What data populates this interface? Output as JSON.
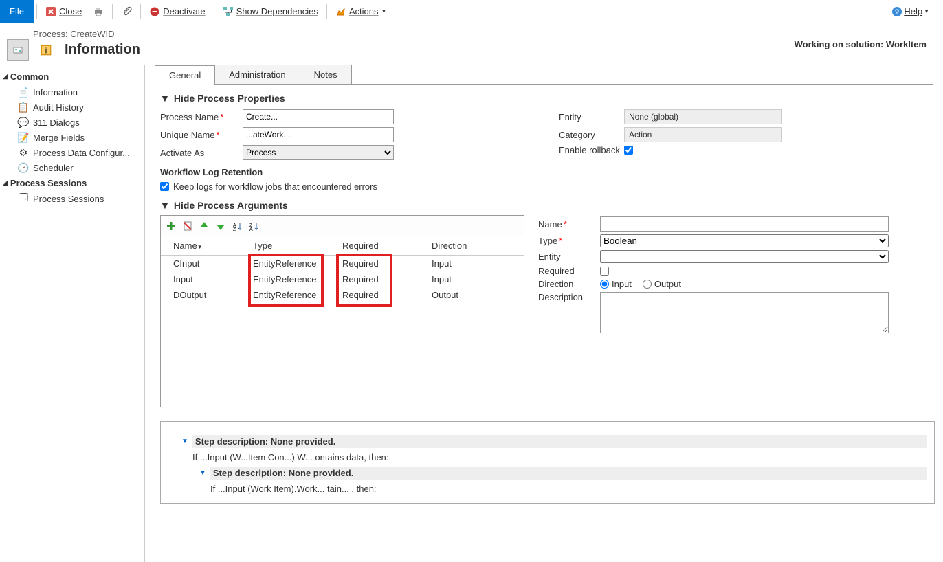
{
  "toolbar": {
    "file": "File",
    "close": "Close",
    "deactivate": "Deactivate",
    "show_deps": "Show Dependencies",
    "actions": "Actions",
    "help": "Help"
  },
  "header": {
    "process_label": "Process: CreateWID",
    "info_label": "Information",
    "solution_prefix": "Working on solution: ",
    "solution_name": "WorkItem"
  },
  "sidebar": {
    "group_common": "Common",
    "items_common": [
      "Information",
      "Audit History",
      "311 Dialogs",
      "Merge Fields",
      "Process Data Configur...",
      "Scheduler"
    ],
    "group_sessions": "Process Sessions",
    "items_sessions": [
      "Process Sessions"
    ]
  },
  "tabs": [
    "General",
    "Administration",
    "Notes"
  ],
  "section_props": "Hide Process Properties",
  "fields": {
    "process_name": "Process Name",
    "process_name_val": "Create...",
    "unique_name": "Unique Name",
    "unique_name_val": "...ateWork...",
    "activate_as": "Activate As",
    "activate_as_val": "Process",
    "entity": "Entity",
    "entity_val": "None (global)",
    "category": "Category",
    "category_val": "Action",
    "enable_rollback": "Enable rollback",
    "wf_log": "Workflow Log Retention",
    "keep_logs": "Keep logs for workflow jobs that encountered errors"
  },
  "section_args": "Hide Process Arguments",
  "grid": {
    "cols": {
      "name": "Name",
      "type": "Type",
      "req": "Required",
      "dir": "Direction"
    },
    "rows": [
      {
        "name": "CInput",
        "type": "EntityReference",
        "req": "Required",
        "dir": "Input"
      },
      {
        "name": "Input",
        "type": "EntityReference",
        "req": "Required",
        "dir": "Input"
      },
      {
        "name": "DOutput",
        "type": "EntityReference",
        "req": "Required",
        "dir": "Output"
      }
    ]
  },
  "argprops": {
    "name": "Name",
    "type": "Type",
    "type_val": "Boolean",
    "entity": "Entity",
    "required": "Required",
    "direction": "Direction",
    "dir_in": "Input",
    "dir_out": "Output",
    "description": "Description"
  },
  "steps": {
    "l1": "Step description: None provided.",
    "l1b": "If ...Input (W...Item Con...) W... ontains data, then:",
    "l2": "Step description: None provided.",
    "l2b": "If ...Input (Work Item).Work... tain... , then:"
  }
}
